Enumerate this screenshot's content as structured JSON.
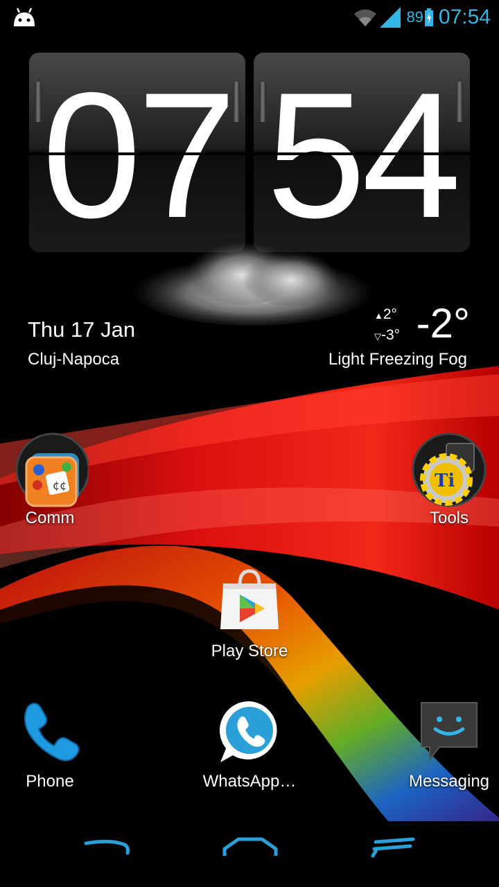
{
  "status_bar": {
    "battery_percent": "89",
    "time": "07:54",
    "accent_color": "#33b5e5"
  },
  "clock_widget": {
    "hours": "07",
    "minutes": "54"
  },
  "weather_widget": {
    "date": "Thu 17 Jan",
    "city": "Cluj-Napoca",
    "high": "2°",
    "low": "-3°",
    "temperature": "-2°",
    "condition": "Light Freezing Fog",
    "icon": "fog-cloud-icon"
  },
  "home_apps": [
    {
      "label": "Comm",
      "icon": "comm-folder-icon"
    },
    {
      "label": "Tools",
      "icon": "tools-folder-icon"
    },
    {
      "label": "Play Store",
      "icon": "play-store-icon"
    }
  ],
  "dock_apps": [
    {
      "label": "Phone",
      "icon": "phone-icon"
    },
    {
      "label": "WhatsApp…",
      "icon": "whatsapp-icon"
    },
    {
      "label": "Messaging",
      "icon": "messaging-icon"
    }
  ],
  "nav_bar": {
    "buttons": [
      "back-icon",
      "home-icon",
      "recent-apps-icon"
    ]
  }
}
